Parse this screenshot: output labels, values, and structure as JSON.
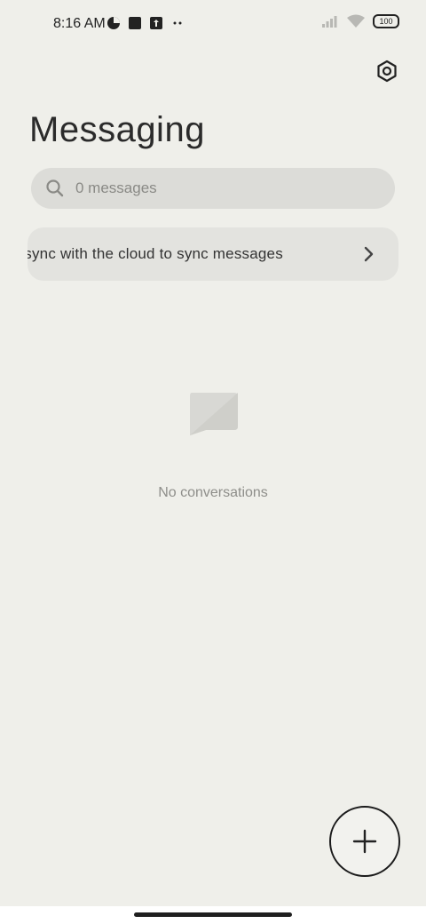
{
  "status_bar": {
    "time": "8:16 AM",
    "battery": "100"
  },
  "header": {
    "title": "Messaging"
  },
  "search": {
    "placeholder": "0 messages"
  },
  "sync_banner": {
    "text": "Turn on sync with the cloud to sync messages"
  },
  "empty_state": {
    "text": "No conversations"
  },
  "icons": {
    "settings": "settings-icon",
    "search": "search-icon",
    "chevron": "chevron-right-icon",
    "empty": "message-bubble-icon",
    "fab": "plus-icon"
  }
}
